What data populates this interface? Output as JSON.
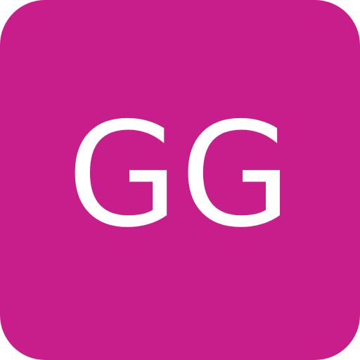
{
  "avatar": {
    "initials": "GG",
    "background_color": "#C81E8C",
    "text_color": "#FFFFFF"
  }
}
